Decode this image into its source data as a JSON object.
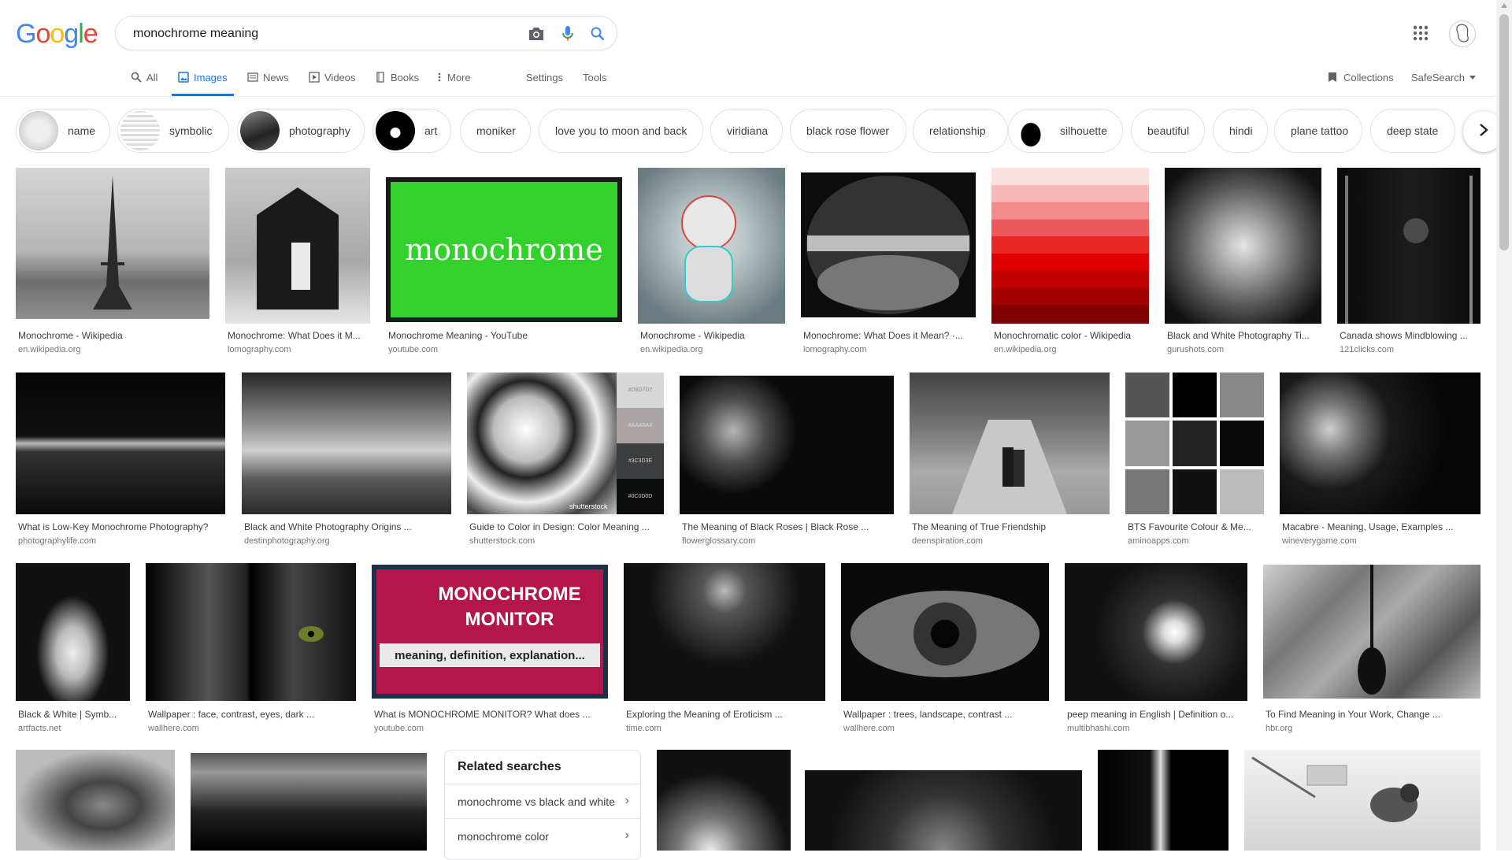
{
  "header": {
    "logo": [
      "G",
      "o",
      "o",
      "g",
      "l",
      "e"
    ],
    "logo_colors": [
      "#4285F4",
      "#EA4335",
      "#FBBC05",
      "#4285F4",
      "#34A853",
      "#EA4335"
    ],
    "search_value": "monochrome meaning"
  },
  "tabs": {
    "all": "All",
    "images": "Images",
    "news": "News",
    "videos": "Videos",
    "books": "Books",
    "more": "More",
    "settings": "Settings",
    "tools": "Tools",
    "collections": "Collections",
    "safesearch": "SafeSearch"
  },
  "chips": [
    "name",
    "symbolic",
    "photography",
    "art",
    "moniker",
    "love you to moon and back",
    "viridiana",
    "black rose flower",
    "relationship",
    "silhouette",
    "beautiful",
    "hindi",
    "plane tattoo",
    "deep state"
  ],
  "results": [
    {
      "title": "Monochrome - Wikipedia",
      "site": "en.wikipedia.org"
    },
    {
      "title": "Monochrome: What Does it M...",
      "site": "lomography.com"
    },
    {
      "title": "Monochrome Meaning - YouTube",
      "site": "youtube.com"
    },
    {
      "title": "Monochrome - Wikipedia",
      "site": "en.wikipedia.org"
    },
    {
      "title": "Monochrome: What Does it Mean? ·...",
      "site": "lomography.com"
    },
    {
      "title": "Monochromatic color - Wikipedia",
      "site": "en.wikipedia.org"
    },
    {
      "title": "Black and White Photography Ti...",
      "site": "gurushots.com"
    },
    {
      "title": "Canada shows Mindblowing ...",
      "site": "121clicks.com"
    },
    {
      "title": "What is Low-Key Monochrome Photography?",
      "site": "photographylife.com"
    },
    {
      "title": "Black and White Photography Origins ...",
      "site": "destinphotography.org"
    },
    {
      "title": "Guide to Color in Design: Color Meaning ...",
      "site": "shutterstock.com"
    },
    {
      "title": "The Meaning of Black Roses | Black Rose ...",
      "site": "flowerglossary.com"
    },
    {
      "title": "The Meaning of True Friendship",
      "site": "deenspiration.com"
    },
    {
      "title": "BTS Favourite Colour & Me...",
      "site": "aminoapps.com"
    },
    {
      "title": "Macabre - Meaning, Usage, Examples ...",
      "site": "wineverygame.com"
    },
    {
      "title": "Black & White | Symb...",
      "site": "artfacts.net"
    },
    {
      "title": "Wallpaper : face, contrast, eyes, dark ...",
      "site": "wallhere.com"
    },
    {
      "title": "What is MONOCHROME MONITOR? What does ...",
      "site": "youtube.com"
    },
    {
      "title": "Exploring the Meaning of Eroticism ...",
      "site": "time.com"
    },
    {
      "title": "Wallpaper : trees, landscape, contrast ...",
      "site": "wallhere.com"
    },
    {
      "title": "peep meaning in English | Definition o...",
      "site": "multibhashi.com"
    },
    {
      "title": "To Find Meaning in Your Work, Change ...",
      "site": "hbr.org"
    }
  ],
  "overlay_text": {
    "monochrome_yt": "monochrome",
    "monitor_line1": "MONOCHROME",
    "monitor_line2": "MONITOR",
    "monitor_line3": "meaning, definition, explanation...",
    "swatch_codes": [
      "#D8D7D7",
      "#AAA5A4",
      "#3C3D3E",
      "#0C0D0D"
    ],
    "watermark": "shutterstock"
  },
  "related": {
    "title": "Related searches",
    "items": [
      "monochrome vs black and white",
      "monochrome color"
    ]
  },
  "icons": {
    "camera": "camera-icon",
    "mic": "mic-icon",
    "search": "search-icon",
    "apps": "apps-grid-icon",
    "next": "chevron-right-icon"
  },
  "colors": {
    "accent": "#1a73e8",
    "text": "#202124",
    "muted": "#70757a"
  }
}
